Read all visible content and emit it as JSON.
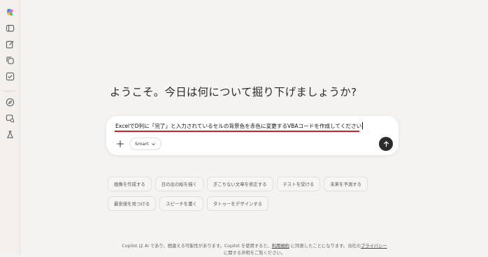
{
  "heading": "ようこそ。今日は何について掘り下げましょうか?",
  "composer": {
    "text": "ExcelでD列に「完了」と入力されているセルの背景色を赤色に変更するVBAコードを作成してください",
    "mode_label": "Smart",
    "plus_icon": "plus-icon",
    "send_icon": "arrow-up-icon"
  },
  "suggestions": {
    "row1": [
      "画像を作成する",
      "日の出の絵を描く",
      "ぎこちない文章を修正する",
      "テストを受ける",
      "未来を予測する"
    ],
    "row2": [
      "最安値を見つける",
      "スピーチを書く",
      "タトゥーをデザインする"
    ]
  },
  "footer": {
    "prefix": "Copilot は AI であり、間違える可能性があります。Copilot を使用すると、",
    "terms_link": "利用規約",
    "middle": " に同意したことになります。当社の",
    "privacy_link": "プライバシー",
    "suffix": "に関する声明をご覧ください。"
  },
  "sidebar_icons": [
    "copilot-logo",
    "sidebar-toggle-icon",
    "new-chat-icon",
    "copy-icon",
    "checklist-icon",
    "discover-icon",
    "image-search-icon",
    "labs-icon"
  ],
  "colors": {
    "accent_underline": "#d21f26",
    "send_button": "#2b2b2b",
    "background": "#f5f3f1"
  }
}
